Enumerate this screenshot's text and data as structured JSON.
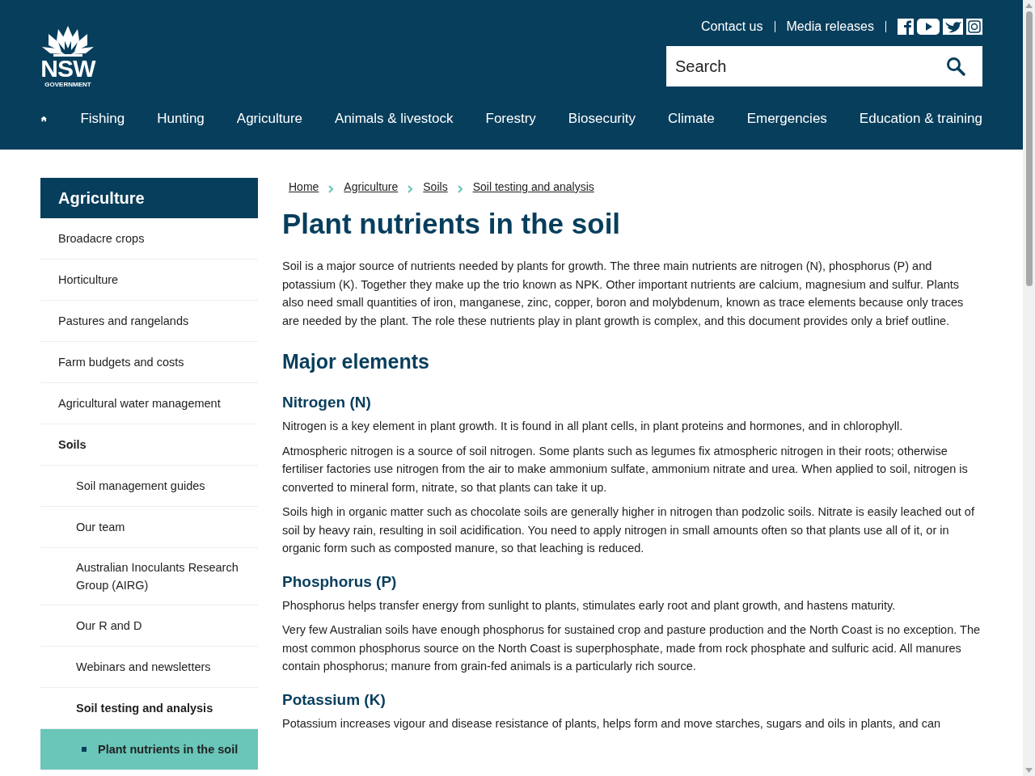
{
  "header": {
    "logo_text": "NSW",
    "logo_subtext": "GOVERNMENT",
    "utility_links": [
      "Contact us",
      "Media releases"
    ],
    "search": {
      "placeholder": "Search"
    }
  },
  "nav": {
    "items": [
      "Fishing",
      "Hunting",
      "Agriculture",
      "Animals & livestock",
      "Forestry",
      "Biosecurity",
      "Climate",
      "Emergencies",
      "Education & training"
    ]
  },
  "sidebar": {
    "title": "Agriculture",
    "items": [
      {
        "label": "Broadacre crops",
        "expanded": false,
        "selected": false
      },
      {
        "label": "Horticulture",
        "expanded": false,
        "selected": false
      },
      {
        "label": "Pastures and rangelands",
        "expanded": false,
        "selected": false
      },
      {
        "label": "Farm budgets and costs",
        "expanded": false,
        "selected": false
      },
      {
        "label": "Agricultural water management",
        "expanded": false,
        "selected": false
      },
      {
        "label": "Soils",
        "expanded": true,
        "selected": false,
        "children": [
          {
            "label": "Soil management guides",
            "expanded": false,
            "selected": false
          },
          {
            "label": "Our team",
            "expanded": false,
            "selected": false
          },
          {
            "label": "Australian Inoculants Research Group (AIRG)",
            "expanded": false,
            "selected": false
          },
          {
            "label": "Our R and D",
            "expanded": false,
            "selected": false
          },
          {
            "label": "Webinars and newsletters",
            "expanded": false,
            "selected": false
          },
          {
            "label": "Soil testing and analysis",
            "expanded": true,
            "selected": false,
            "children": [
              {
                "label": "Plant nutrients in the soil",
                "expanded": false,
                "selected": true
              }
            ]
          }
        ]
      }
    ]
  },
  "breadcrumb": [
    "Home",
    "Agriculture",
    "Soils",
    "Soil testing and analysis"
  ],
  "title": "Plant nutrients in the soil",
  "blocks": [
    {
      "kind": "p",
      "text": "Soil is a major source of nutrients needed by plants for growth. The three main nutrients are nitrogen (N), phosphorus (P) and potassium (K). Together they make up the trio known as NPK. Other important nutrients are calcium, magnesium and sulfur. Plants also need small quantities of iron, manganese, zinc, copper, boron and molybdenum, known as trace elements because only traces are needed by the plant. The role these nutrients play in plant growth is complex, and this document provides only a brief outline."
    },
    {
      "kind": "h2",
      "text": "Major elements"
    },
    {
      "kind": "h3",
      "text": "Nitrogen (N)"
    },
    {
      "kind": "p",
      "text": "Nitrogen is a key element in plant growth. It is found in all plant cells, in plant proteins and hormones, and in chlorophyll."
    },
    {
      "kind": "p",
      "text": "Atmospheric nitrogen is a source of soil nitrogen. Some plants such as legumes fix atmospheric nitrogen in their roots; otherwise fertiliser factories use nitrogen from the air to make ammonium sulfate, ammonium nitrate and urea. When applied to soil, nitrogen is converted to mineral form, nitrate, so that plants can take it up."
    },
    {
      "kind": "p",
      "text": "Soils high in organic matter such as chocolate soils are generally higher in nitrogen than podzolic soils. Nitrate is easily leached out of soil by heavy rain, resulting in soil acidification. You need to apply nitrogen in small amounts often so that plants use all of it, or in organic form such as composted manure, so that leaching is reduced."
    },
    {
      "kind": "h3",
      "text": "Phosphorus (P)"
    },
    {
      "kind": "p",
      "text": "Phosphorus helps transfer energy from sunlight to plants, stimulates early root and plant growth, and hastens maturity."
    },
    {
      "kind": "p",
      "text": "Very few Australian soils have enough phosphorus for sustained crop and pasture production and the North Coast is no exception. The most common phosphorus source on the North Coast is superphosphate, made from rock phosphate and sulfuric acid. All manures contain phosphorus; manure from grain-fed animals is a particularly rich source."
    },
    {
      "kind": "h3",
      "text": "Potassium (K)"
    },
    {
      "kind": "p",
      "text": "Potassium increases vigour and disease resistance of plants, helps form and move starches, sugars and oils in plants, and can"
    }
  ]
}
